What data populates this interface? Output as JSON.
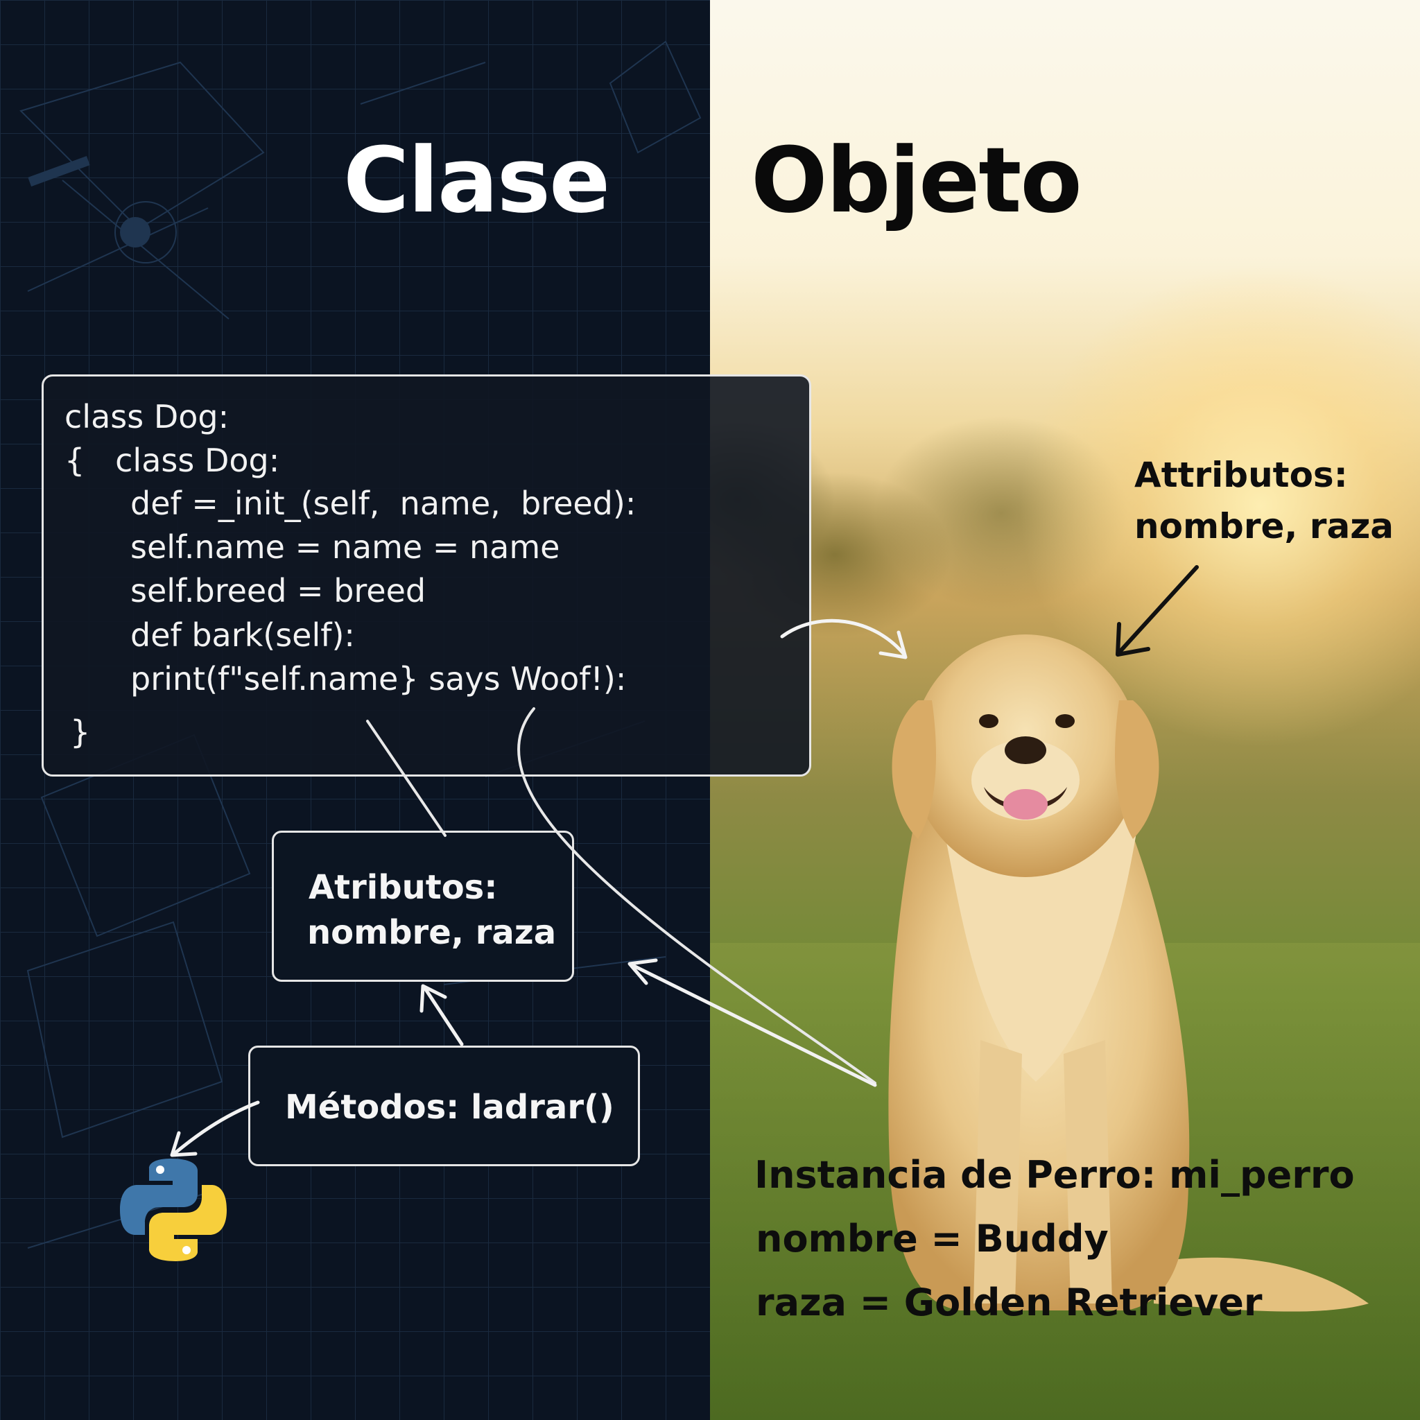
{
  "titles": {
    "class_heading": "Clase",
    "object_heading": "Objeto"
  },
  "code": {
    "lines": [
      "class Dog:",
      "{   class Dog:",
      "def =_init_(self,  name,  breed):",
      "self.name = name = name",
      "self.breed = breed",
      "def bark(self):",
      "print(f\"self.name} says Woof!):",
      "}"
    ]
  },
  "attributes_box": {
    "line1": "Atributos:",
    "line2": "nombre, raza"
  },
  "methods_box": {
    "label": "Métodos: ladrar()"
  },
  "object_attributes_label": {
    "line1": "Attributos:",
    "line2": "nombre, raza"
  },
  "instance_info": {
    "line1": "Instancia de Perro: mi_perro",
    "line2": "nombre = Buddy",
    "line3": "raza = Golden Retriever"
  },
  "colors": {
    "left_background": "#0b1422",
    "python_blue": "#3f77aa",
    "python_yellow": "#f7cf3c",
    "dog_fur": "#e8c688"
  },
  "icons": {
    "language_logo": "python-logo-icon",
    "subject": "golden-retriever-dog"
  }
}
